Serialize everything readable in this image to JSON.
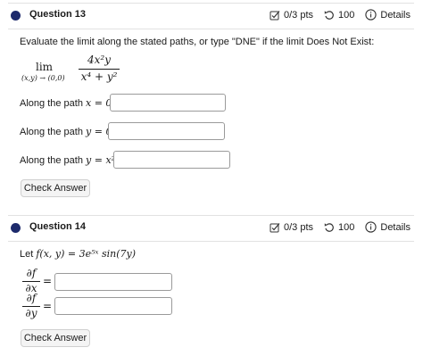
{
  "q1": {
    "title": "Question 13",
    "score": "0/3 pts",
    "attempts": "100",
    "details": "Details",
    "prompt": "Evaluate the limit along the stated paths, or type \"DNE\" if the limit Does Not Exist:",
    "limit": {
      "lim_word": "lim",
      "lim_subscript": "(x,y) → (0,0)",
      "numerator": "4x²y",
      "denominator": "x⁴ + y²"
    },
    "paths": [
      {
        "label_text": "Along the path",
        "expr": "x = 0:",
        "value": ""
      },
      {
        "label_text": "Along the path",
        "expr": "y = 0:",
        "value": ""
      },
      {
        "label_text": "Along the path",
        "expr": "y = x²:",
        "value": ""
      }
    ],
    "check_label": "Check Answer"
  },
  "q2": {
    "title": "Question 14",
    "score": "0/3 pts",
    "attempts": "100",
    "details": "Details",
    "let_text": "Let",
    "function_expr": "f(x, y) = 3e⁵ˣ sin(7y)",
    "partials": [
      {
        "numerator": "∂f",
        "denominator": "∂x",
        "equals": "=",
        "value": ""
      },
      {
        "numerator": "∂f",
        "denominator": "∂y",
        "equals": "=",
        "value": ""
      }
    ],
    "check_label": "Check Answer"
  },
  "colors": {
    "accent_dot": "#1d2a6b"
  },
  "icons": [
    "edit-check-icon",
    "retry-icon",
    "info-icon"
  ]
}
